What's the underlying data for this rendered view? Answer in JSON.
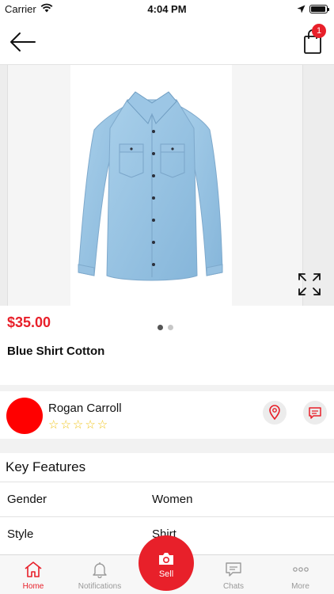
{
  "status_bar": {
    "carrier": "Carrier",
    "time": "4:04 PM"
  },
  "header": {
    "cart_count": "1"
  },
  "gallery": {
    "active_index": 1,
    "total": 2
  },
  "product": {
    "price": "$35.00",
    "name": "Blue Shirt Cotton"
  },
  "seller": {
    "name": "Rogan Carroll",
    "rating": 0,
    "rating_max": 5,
    "stars_text": "☆☆☆☆☆",
    "avatar_color": "#ff0000"
  },
  "features": {
    "title": "Key Features",
    "rows": [
      {
        "key": "Gender",
        "value": "Women"
      },
      {
        "key": "Style",
        "value": "Shirt"
      }
    ]
  },
  "tab_bar": {
    "home": "Home",
    "notifications": "Notifications",
    "sell": "Sell",
    "chats": "Chats",
    "more": "More"
  },
  "colors": {
    "accent": "#e8202a",
    "star": "#f0c419"
  }
}
